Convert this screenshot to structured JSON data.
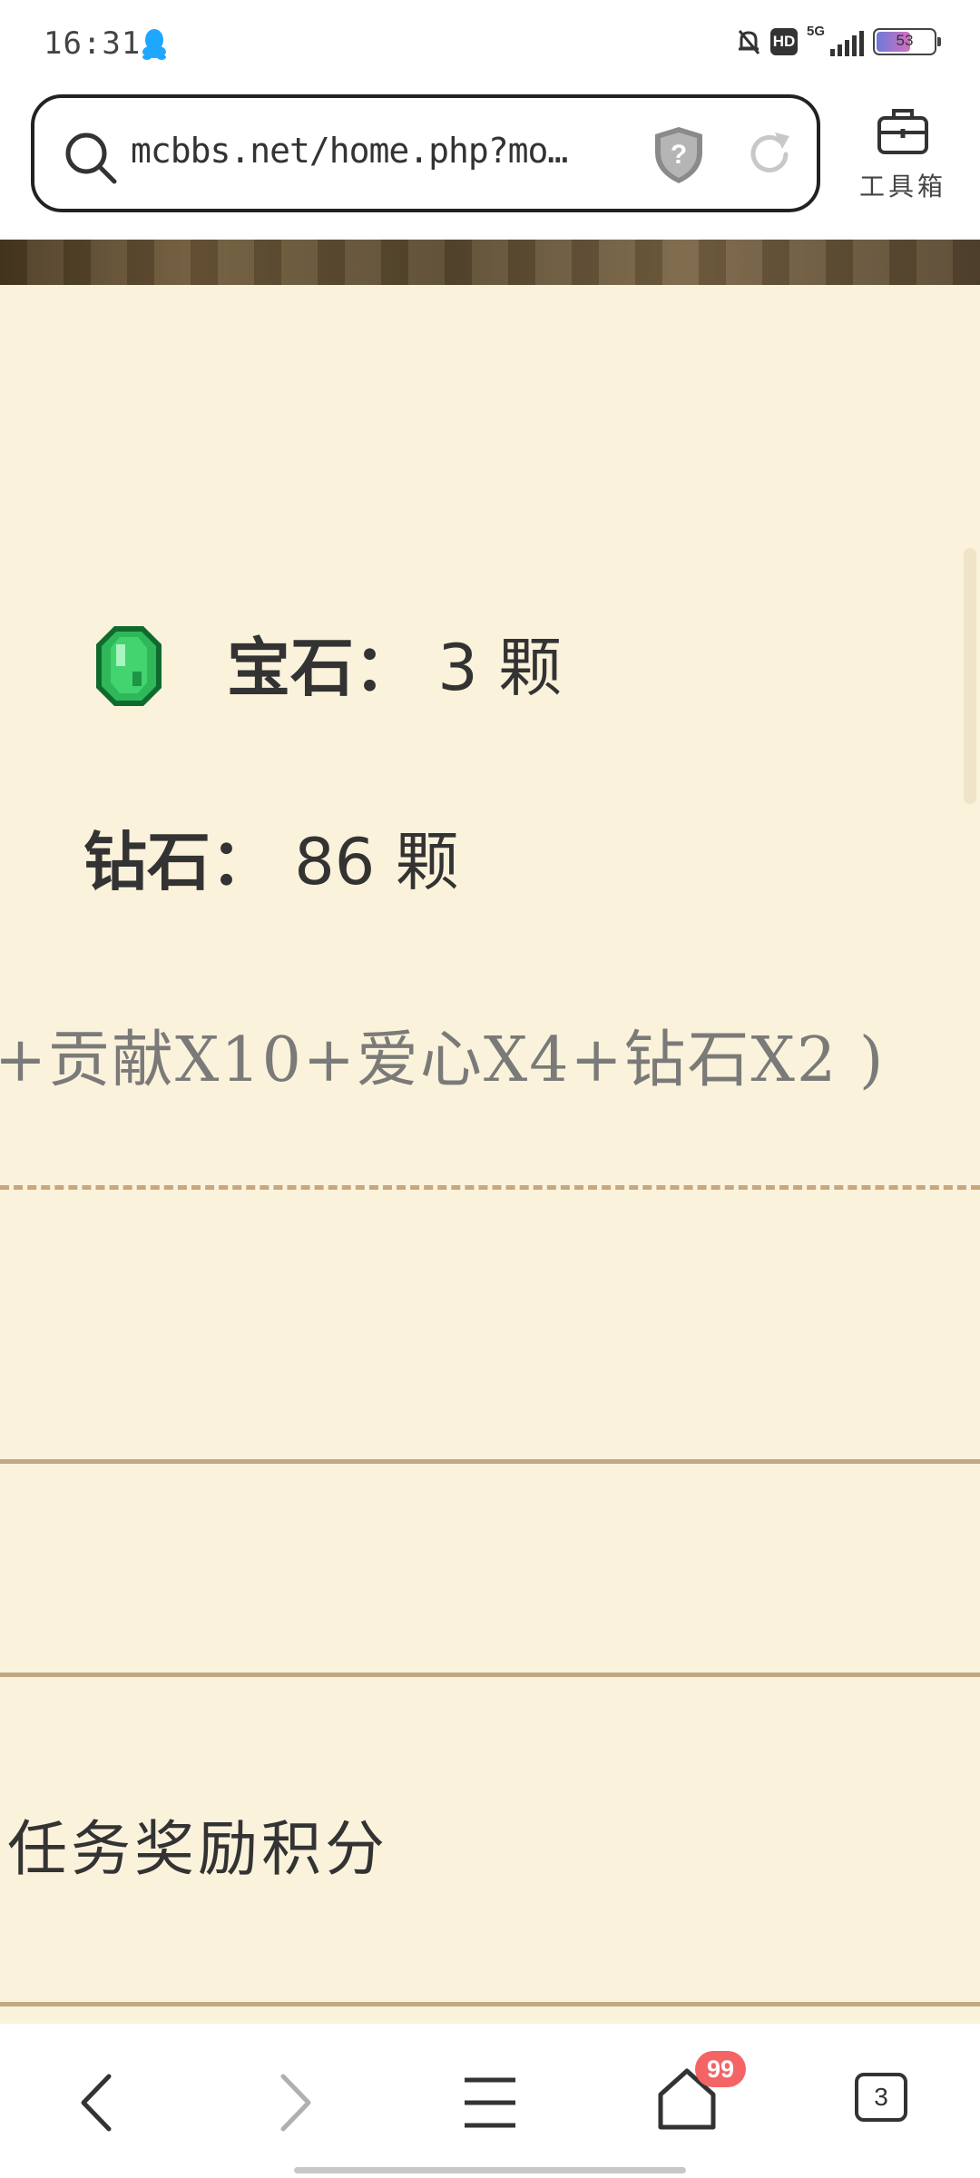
{
  "status": {
    "time": "16:31",
    "battery": "53",
    "network": "5G",
    "hd": "HD"
  },
  "browser": {
    "url": "mcbbs.net/home.php?mo…",
    "toolbox_label": "工具箱"
  },
  "content": {
    "gem_label": "宝石：",
    "gem_value": "3",
    "gem_unit": "颗",
    "diamond_label": "钻石：",
    "diamond_value": "86",
    "diamond_unit": "颗",
    "formula": "+贡献X10+爱心X4+钻石X2 )",
    "section_heading": "任务奖励积分"
  },
  "nav": {
    "home_badge": "99",
    "tab_count": "3"
  },
  "colors": {
    "page_bg": "#fbf2dc",
    "divider": "#c1a87f",
    "badge": "#f46465",
    "gem_green": "#2fb85a"
  }
}
